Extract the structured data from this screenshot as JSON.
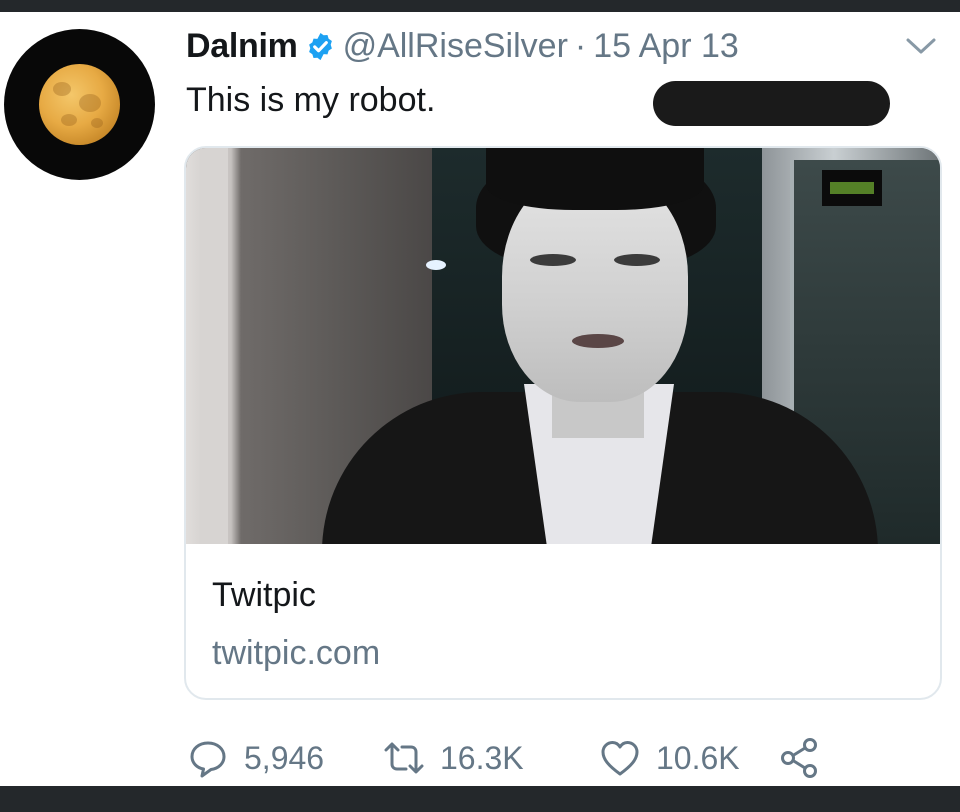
{
  "tweet": {
    "author_name": "Dalnim",
    "handle": "@AllRiseSilver",
    "separator": "·",
    "date": "15 Apr 13",
    "text": "This is my robot.",
    "avatar_icon": "moon-avatar",
    "verified_icon": "verified-badge-icon",
    "menu_icon": "chevron-down-icon"
  },
  "card": {
    "title": "Twitpic",
    "domain": "twitpic.com",
    "media_description_icon": "photo-thumbnail"
  },
  "actions": {
    "reply_count": "5,946",
    "retweet_count": "16.3K",
    "like_count": "10.6K",
    "reply_icon": "reply-icon",
    "retweet_icon": "retweet-icon",
    "like_icon": "heart-icon",
    "share_icon": "share-icon"
  },
  "colors": {
    "text_primary": "#14171a",
    "text_secondary": "#657786",
    "verified_blue": "#1da1f2",
    "border": "#e1e8ed",
    "frame_dark": "#24282b"
  }
}
